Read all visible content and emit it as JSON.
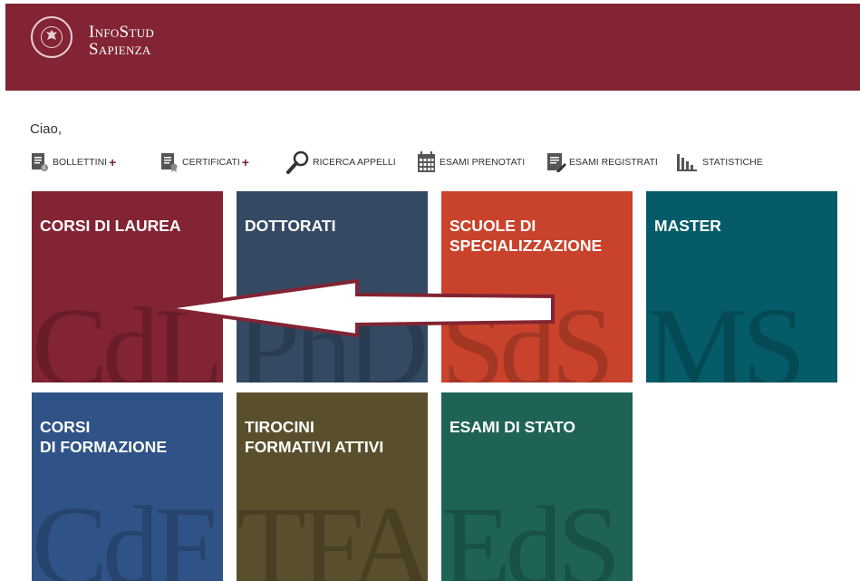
{
  "header": {
    "brand_line1": "InfoStud",
    "brand_line2": "Sapienza",
    "logo": "sapienza-seal-icon",
    "background": "#822433"
  },
  "greeting": "Ciao,",
  "toolbar": {
    "items": [
      {
        "label": "BOLLETTINI",
        "icon": "document-icon",
        "has_plus": true
      },
      {
        "label": "CERTIFICATI",
        "icon": "certificate-icon",
        "has_plus": true
      },
      {
        "label": "RICERCA APPELLI",
        "icon": "search-icon",
        "has_plus": false
      },
      {
        "label": "ESAMI PRENOTATI",
        "icon": "calendar-icon",
        "has_plus": false
      },
      {
        "label": "ESAMI REGISTRATI",
        "icon": "edit-document-icon",
        "has_plus": false
      },
      {
        "label": "STATISTICHE",
        "icon": "bar-chart-icon",
        "has_plus": false
      }
    ],
    "plus": "+"
  },
  "tiles": [
    {
      "title": "CORSI DI LAUREA",
      "watermark": "CdL",
      "color": "#822433"
    },
    {
      "title": "DOTTORATI",
      "watermark": "PhD",
      "color": "#344a63"
    },
    {
      "title": "SCUOLE DI\nSPECIALIZZAZIONE",
      "watermark": "SdS",
      "color": "#c9432c"
    },
    {
      "title": "MASTER",
      "watermark": "MS",
      "color": "#055b68"
    },
    {
      "title": "CORSI\nDI FORMAZIONE",
      "watermark": "CdF",
      "color": "#2f5386"
    },
    {
      "title": "TIROCINI\nFORMATIVI ATTIVI",
      "watermark": "TFA",
      "color": "#5a4f2c"
    },
    {
      "title": "ESAMI DI STATO",
      "watermark": "EdS",
      "color": "#1e6356"
    }
  ],
  "annotation": {
    "type": "arrow",
    "points_to": "CORSI DI LAUREA",
    "fill": "#ffffff",
    "stroke": "#822433"
  }
}
